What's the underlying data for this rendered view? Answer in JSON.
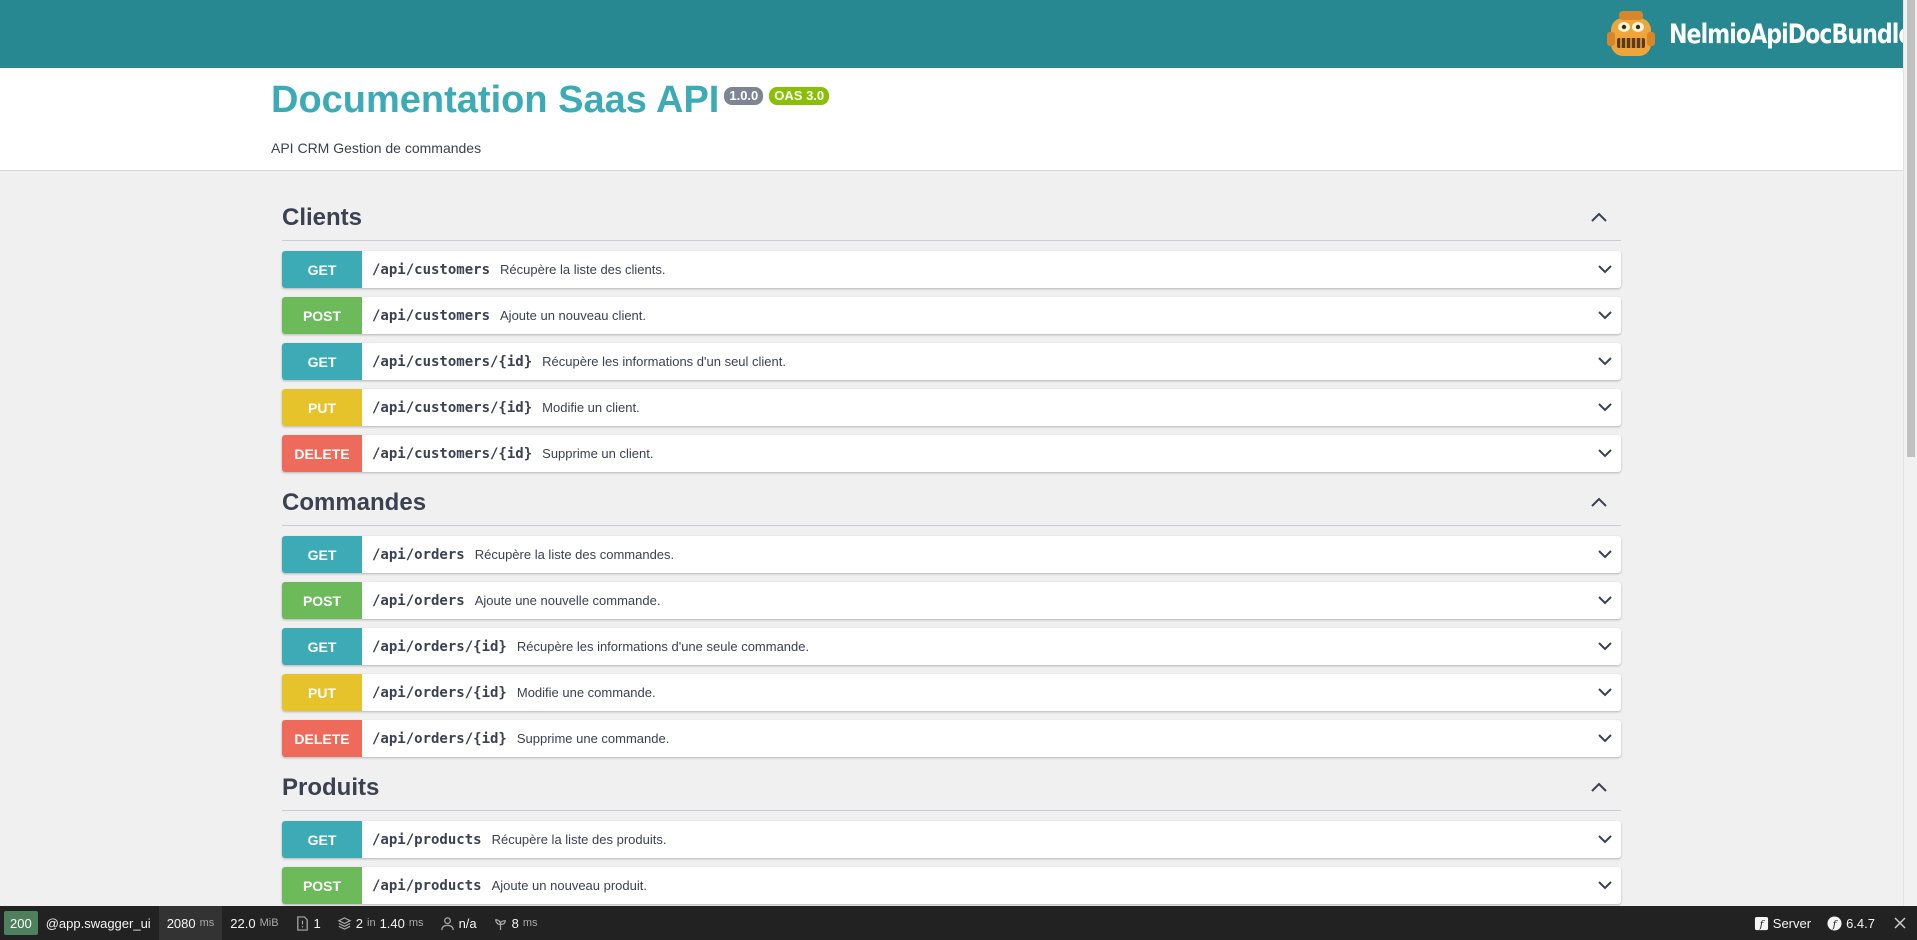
{
  "header": {
    "brand_name": "NelmioApiDocBundle",
    "background_color": "#278892"
  },
  "info": {
    "title": "Documentation Saas API",
    "version_badge": "1.0.0",
    "oas_badge": "OAS 3.0",
    "description": "API CRM Gestion de commandes"
  },
  "tags": [
    {
      "name": "Clients",
      "expanded": true,
      "operations": [
        {
          "method": "GET",
          "path": "/api/customers",
          "summary": "Récupère la liste des clients."
        },
        {
          "method": "POST",
          "path": "/api/customers",
          "summary": "Ajoute un nouveau client."
        },
        {
          "method": "GET",
          "path": "/api/customers/{id}",
          "summary": "Récupère les informations d'un seul client."
        },
        {
          "method": "PUT",
          "path": "/api/customers/{id}",
          "summary": "Modifie un client."
        },
        {
          "method": "DELETE",
          "path": "/api/customers/{id}",
          "summary": "Supprime un client."
        }
      ]
    },
    {
      "name": "Commandes",
      "expanded": true,
      "operations": [
        {
          "method": "GET",
          "path": "/api/orders",
          "summary": "Récupère la liste des commandes."
        },
        {
          "method": "POST",
          "path": "/api/orders",
          "summary": "Ajoute une nouvelle commande."
        },
        {
          "method": "GET",
          "path": "/api/orders/{id}",
          "summary": "Récupère les informations d'une seule commande."
        },
        {
          "method": "PUT",
          "path": "/api/orders/{id}",
          "summary": "Modifie une commande."
        },
        {
          "method": "DELETE",
          "path": "/api/orders/{id}",
          "summary": "Supprime une commande."
        }
      ]
    },
    {
      "name": "Produits",
      "expanded": true,
      "operations": [
        {
          "method": "GET",
          "path": "/api/products",
          "summary": "Récupère la liste des produits."
        },
        {
          "method": "POST",
          "path": "/api/products",
          "summary": "Ajoute un nouveau produit."
        }
      ]
    }
  ],
  "method_colors": {
    "GET": "#3dabb6",
    "POST": "#6cba5a",
    "PUT": "#e6c22b",
    "DELETE": "#ee6b5b"
  },
  "toolbar": {
    "status_code": "200",
    "route": "@app.swagger_ui",
    "time_value": "2080",
    "time_unit": "ms",
    "memory_value": "22.0",
    "memory_unit": "MiB",
    "logs_count": "1",
    "cache_value": "2",
    "cache_in": "in",
    "cache_time": "1.40",
    "cache_unit": "ms",
    "security_user": "n/a",
    "twig_value": "8",
    "twig_unit": "ms",
    "server_label": "Server",
    "symfony_version": "6.4.7"
  }
}
